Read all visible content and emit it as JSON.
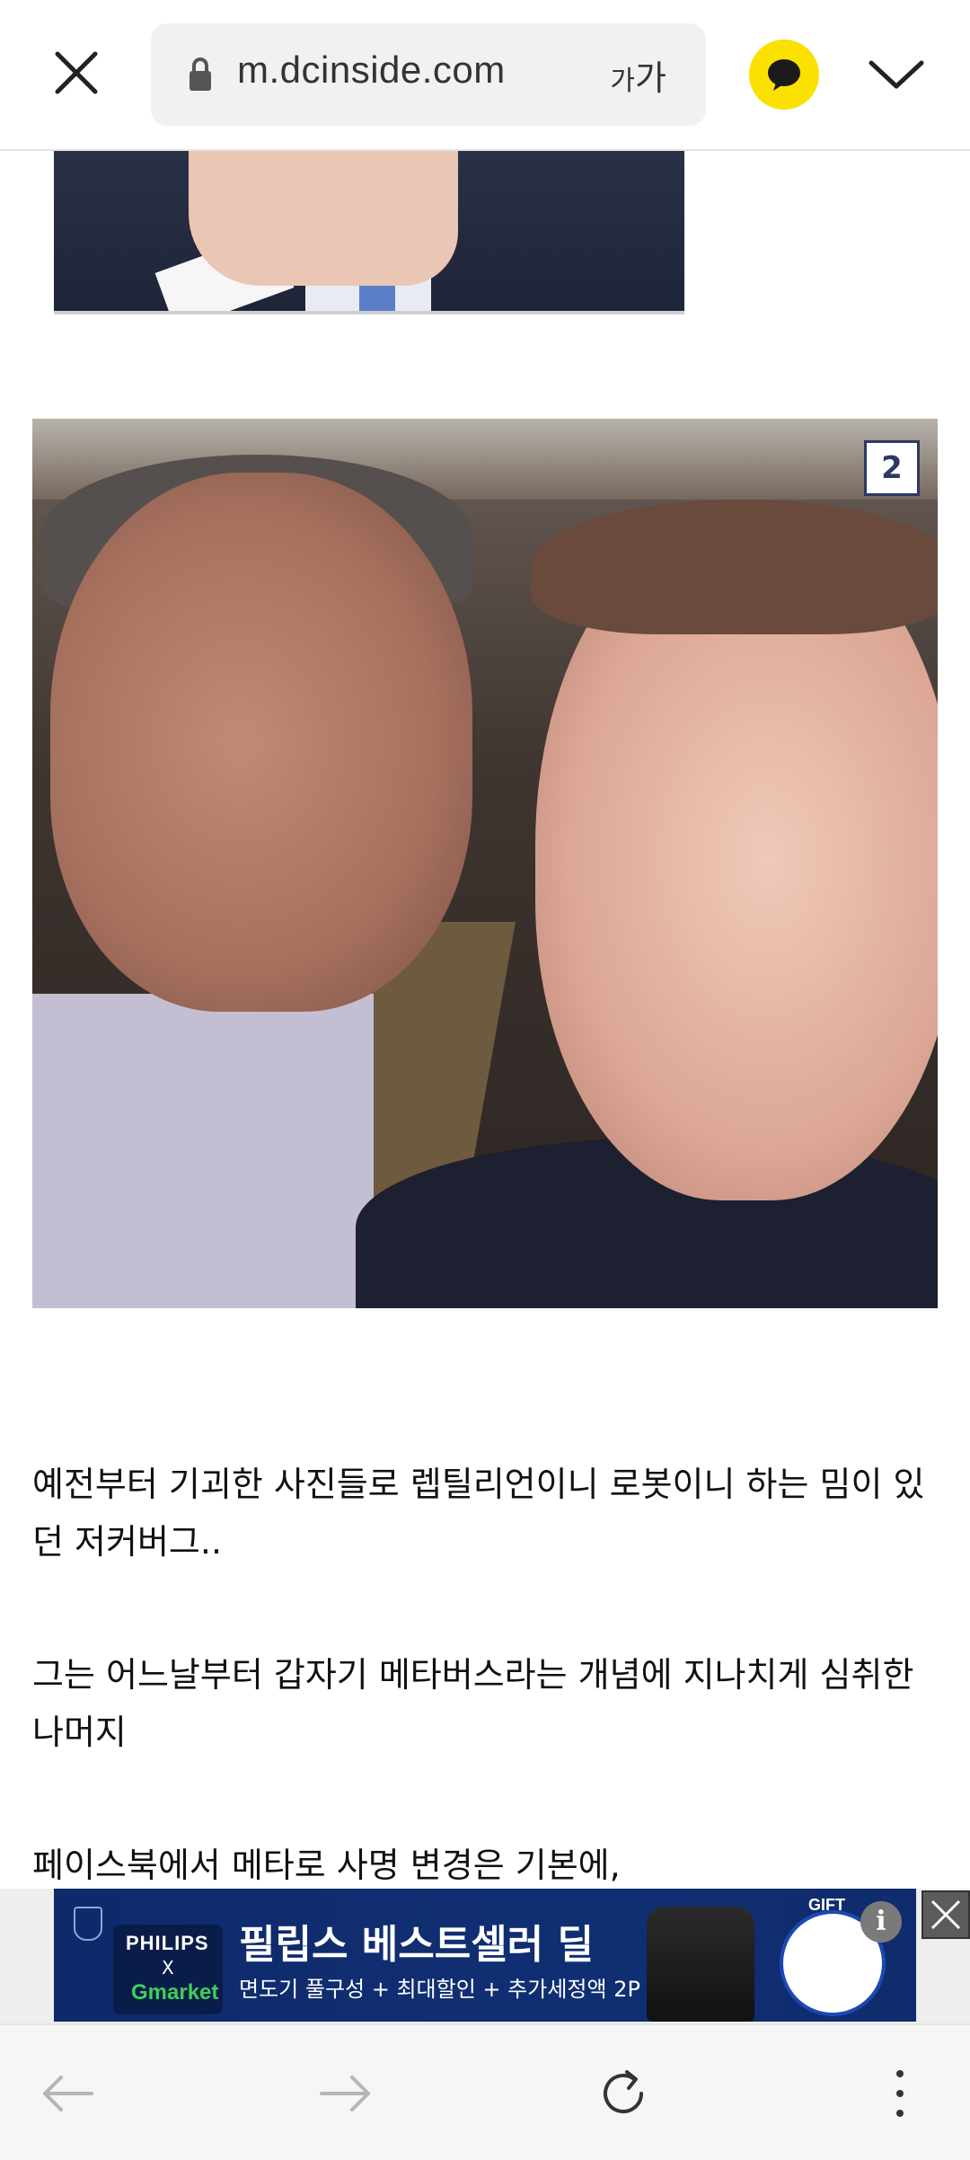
{
  "browser": {
    "url": "m.dcinside.com",
    "text_size_label_small": "가",
    "text_size_label_large": "가"
  },
  "article": {
    "image2_badge": "2",
    "paragraphs": [
      "예전부터 기괴한 사진들로 렙틸리언이니 로봇이니 하는 밈이 있던 저커버그..",
      "그는 어느날부터 갑자기 메타버스라는 개념에 지나치게 심취한 나머지",
      "페이스북에서 메타로 사명 변경은 기본에,"
    ]
  },
  "ad": {
    "brand": "PHILIPS",
    "x": "X",
    "partner": "Gmarket",
    "headline": "필립스 베스트셀러 딜",
    "subline": "면도기 풀구성 + 최대할인 + 추가세정액 2P",
    "gift_label": "GIFT",
    "info_label": "i"
  },
  "colors": {
    "kakao_yellow": "#fae100",
    "ad_blue": "#102f73"
  }
}
